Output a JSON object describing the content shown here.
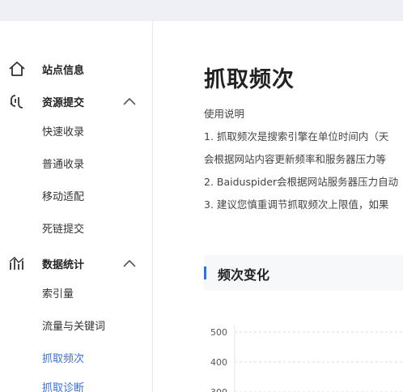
{
  "sidebar": {
    "groups": [
      {
        "label": "站点信息",
        "icon": "home-icon"
      },
      {
        "label": "资源提交",
        "icon": "link-icon",
        "expanded": true,
        "items": [
          "快速收录",
          "普通收录",
          "移动适配",
          "死链提交"
        ]
      },
      {
        "label": "数据统计",
        "icon": "chart-icon",
        "expanded": true,
        "items": [
          "索引量",
          "流量与关键词",
          "抓取频次",
          "抓取诊断"
        ]
      }
    ],
    "active_item": "抓取频次"
  },
  "main": {
    "title": "抓取频次",
    "usage_title": "使用说明",
    "usage_lines": [
      "1. 抓取频次是搜索引擎在单位时间内（天",
      "会根据网站内容更新频率和服务器压力等",
      "2. Baiduspider会根据网站服务器压力自动",
      "3. 建议您慎重调节抓取频次上限值，如果"
    ],
    "section_title": "频次变化"
  },
  "chart_data": {
    "type": "line",
    "y_ticks": [
      500,
      400,
      300
    ],
    "grid": true
  },
  "colors": {
    "accent": "#3a6fd8",
    "topbar": "#eef0f6",
    "section_bg": "#f7f8fa"
  }
}
